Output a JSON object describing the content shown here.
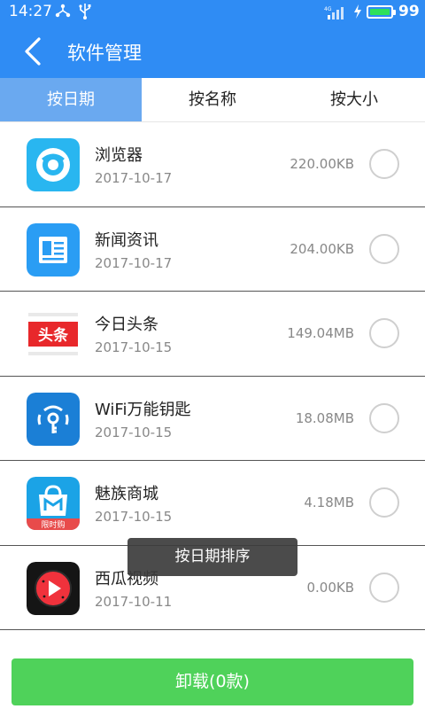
{
  "status_bar": {
    "time": "14:27",
    "battery_percent": "99",
    "signal_label": "4G",
    "icons": [
      "share-icon",
      "usb-icon",
      "signal-icon",
      "charging-icon",
      "battery-icon"
    ]
  },
  "header": {
    "title": "软件管理"
  },
  "tabs": [
    {
      "label": "按日期",
      "active": true
    },
    {
      "label": "按名称",
      "active": false
    },
    {
      "label": "按大小",
      "active": false
    }
  ],
  "apps": [
    {
      "name": "浏览器",
      "date": "2017-10-17",
      "size": "220.00KB",
      "icon": "browser-icon"
    },
    {
      "name": "新闻资讯",
      "date": "2017-10-17",
      "size": "204.00KB",
      "icon": "news-icon"
    },
    {
      "name": "今日头条",
      "date": "2017-10-15",
      "size": "149.04MB",
      "icon": "toutiao-icon",
      "icon_text": "头条"
    },
    {
      "name": "WiFi万能钥匙",
      "date": "2017-10-15",
      "size": "18.08MB",
      "icon": "wifi-key-icon"
    },
    {
      "name": "魅族商城",
      "date": "2017-10-15",
      "size": "4.18MB",
      "icon": "meizu-mall-icon",
      "icon_text": "限时购"
    },
    {
      "name": "西瓜视频",
      "date": "2017-10-11",
      "size": "0.00KB",
      "icon": "xigua-video-icon"
    }
  ],
  "toast": "按日期排序",
  "bottom": {
    "uninstall_label": "卸载(0款)"
  },
  "colors": {
    "primary": "#2f8cf4",
    "tab_active": "#6aa9f0",
    "button": "#4fd25a"
  }
}
